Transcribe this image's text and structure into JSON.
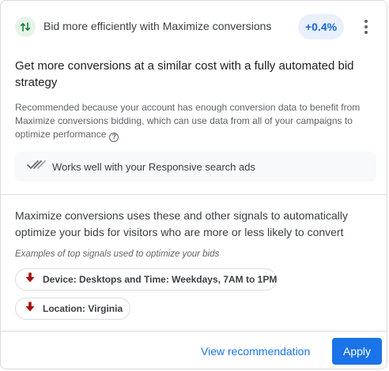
{
  "header": {
    "title": "Bid more efficiently with Maximize conversions",
    "uplift": "+0.4%",
    "icon": "trending-arrows-icon",
    "menu_icon": "more-vert-icon"
  },
  "headline": "Get more conversions at a similar cost with a fully automated bid strategy",
  "reason": "Recommended because your account has enough conversion data to benefit from Maximize conversions bidding, which can use data from all of your campaigns to optimize performance",
  "reason_help_icon": "help-circle-icon",
  "works_well": {
    "label": "Works well with your Responsive search ads",
    "icon": "double-check-icon"
  },
  "signals": {
    "description": "Maximize conversions uses these and other signals to automatically optimize your bids for visitors who are more or less likely to convert",
    "examples_label": "Examples of top signals used to optimize your bids",
    "chips": [
      {
        "label": "Device: Desktops and Time: Weekdays, 7AM to 1PM",
        "icon": "arrow-down-icon"
      },
      {
        "label": "Location: Virginia",
        "icon": "arrow-down-icon"
      }
    ]
  },
  "actions": {
    "view_label": "View recommendation",
    "apply_label": "Apply"
  },
  "colors": {
    "accent": "#1a73e8",
    "uplift_bg": "#e8f0fe",
    "icon_green": "#188038",
    "arrow_red": "#a50e0e"
  }
}
